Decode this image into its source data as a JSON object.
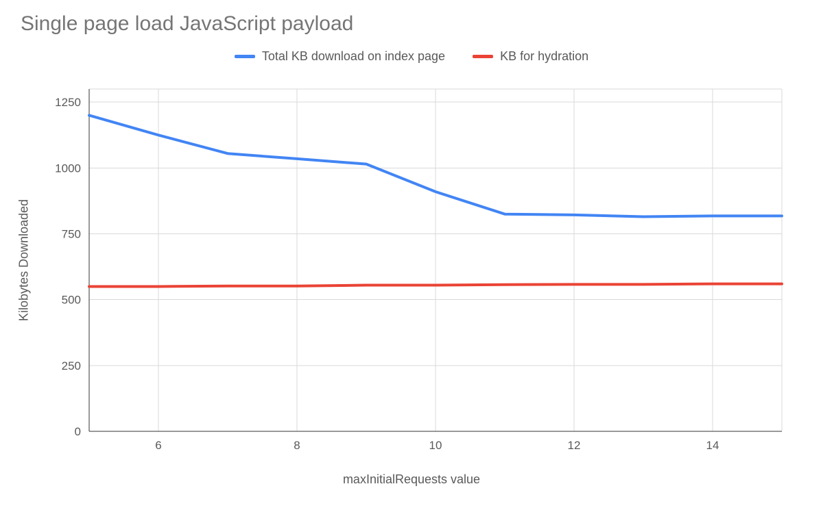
{
  "chart_data": {
    "type": "line",
    "title": "Single page load JavaScript payload",
    "xlabel": "maxInitialRequests value",
    "ylabel": "Kilobytes Downloaded",
    "x": [
      5,
      6,
      7,
      8,
      9,
      10,
      11,
      12,
      13,
      14,
      15
    ],
    "x_ticks": [
      6,
      8,
      10,
      12,
      14
    ],
    "y_ticks": [
      0,
      250,
      500,
      750,
      1000,
      1250
    ],
    "xlim": [
      5,
      15
    ],
    "ylim": [
      0,
      1300
    ],
    "series": [
      {
        "name": "Total KB download on index page",
        "color": "#4285f4",
        "values": [
          1200,
          1125,
          1055,
          1035,
          1015,
          910,
          825,
          822,
          815,
          818,
          818
        ]
      },
      {
        "name": "KB for hydration",
        "color": "#ea4335",
        "values": [
          550,
          550,
          552,
          552,
          555,
          555,
          557,
          558,
          558,
          560,
          560
        ]
      }
    ]
  }
}
